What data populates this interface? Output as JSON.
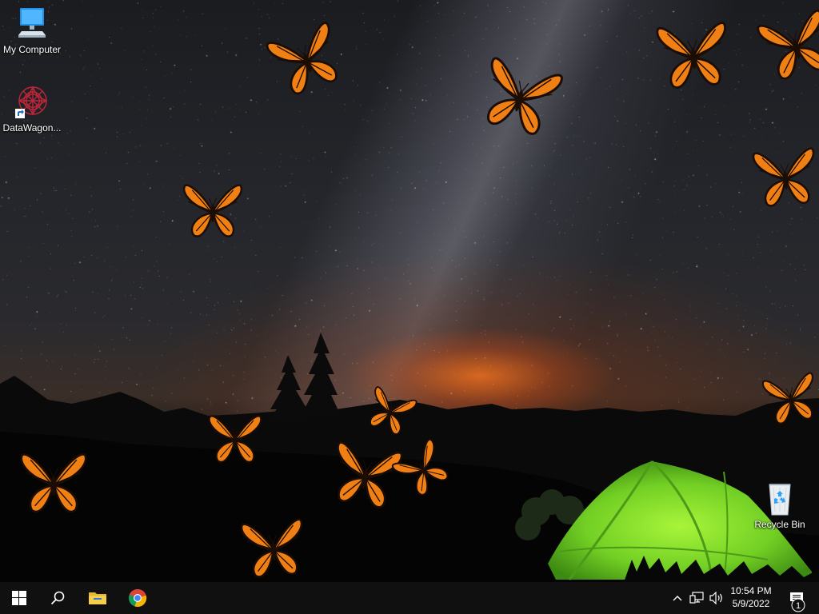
{
  "desktop": {
    "icons": [
      {
        "label": "My Computer",
        "icon": "computer-icon"
      },
      {
        "label": "DataWagon...",
        "icon": "datawagon-shortcut-icon"
      },
      {
        "label": "Recycle Bin",
        "icon": "recycle-bin-icon"
      }
    ],
    "wallpaper": "night-sky-butterflies-tent"
  },
  "taskbar": {
    "start_icon": "windows-logo-icon",
    "search_icon": "search-icon",
    "pinned": [
      {
        "name": "File Explorer",
        "icon": "folder-icon"
      },
      {
        "name": "Google Chrome",
        "icon": "chrome-icon"
      }
    ],
    "tray": {
      "chevron_icon": "chevron-up-icon",
      "network_icon": "network-icon",
      "volume_icon": "volume-icon"
    },
    "clock": {
      "time": "10:54 PM",
      "date": "5/9/2022"
    },
    "notifications": {
      "icon": "action-center-icon",
      "count": "1"
    }
  },
  "colors": {
    "taskbar": "#101010",
    "butterfly_orange": "#f07f14",
    "tent_green": "#7fd62a",
    "horizon_glow": "#ff7a1e",
    "icon_blue": "#2aa3ff"
  }
}
